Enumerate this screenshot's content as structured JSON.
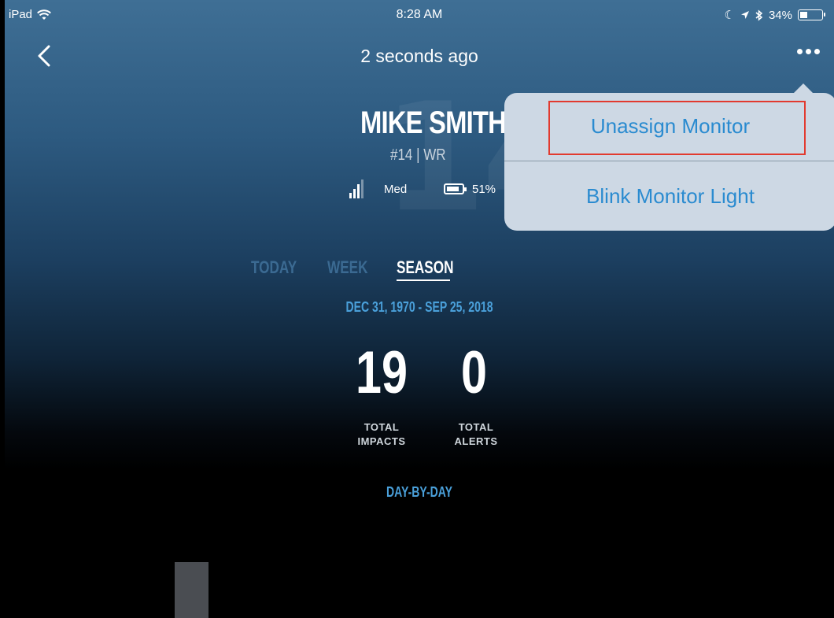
{
  "status_bar": {
    "device": "iPad",
    "time": "8:28 AM",
    "battery_percent": "34%",
    "battery_level": 0.34
  },
  "nav": {
    "title": "2 seconds ago"
  },
  "player": {
    "name": "MIKE SMITH",
    "number_position": "#14  |  WR",
    "background_number": "14",
    "signal_label": "Med",
    "battery_label": "51%"
  },
  "popup_menu": {
    "items": [
      "Unassign Monitor",
      "Blink Monitor Light"
    ],
    "highlighted_item": "Unassign Monitor",
    "text_color": "#2a8bd0",
    "highlight_color": "#e23a2f"
  },
  "tabs": {
    "items": [
      "TODAY",
      "WEEK",
      "SEASON"
    ],
    "selected": "SEASON"
  },
  "date_range": "DEC 31, 1970 - SEP 25, 2018",
  "stats": {
    "total_impacts": {
      "value": "19",
      "label_line1": "TOTAL",
      "label_line2": "IMPACTS"
    },
    "total_alerts": {
      "value": "0",
      "label_line1": "TOTAL",
      "label_line2": "ALERTS"
    }
  },
  "section": {
    "day_by_day": "DAY-BY-DAY"
  },
  "colors": {
    "accent_blue": "#4aa0da",
    "inactive_tab": "#3b6a92"
  }
}
